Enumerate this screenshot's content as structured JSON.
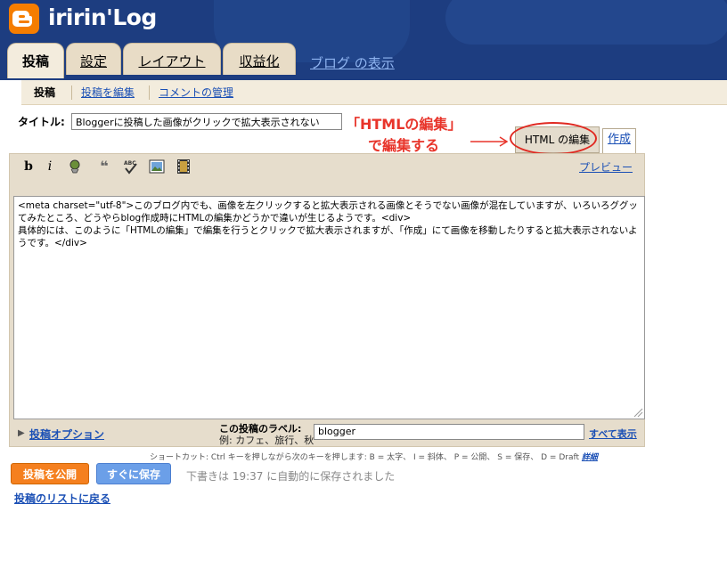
{
  "header": {
    "blog_title": "iririn'Log"
  },
  "tabs": [
    {
      "label": "投稿",
      "active": true
    },
    {
      "label": "設定"
    },
    {
      "label": "レイアウト"
    },
    {
      "label": "収益化"
    }
  ],
  "view_blog_link": "ブログ の表示",
  "subnav": [
    {
      "label": "投稿",
      "active": true
    },
    {
      "label": "投稿を編集"
    },
    {
      "label": "コメントの管理"
    }
  ],
  "post": {
    "title_label": "タイトル:",
    "title_value": "Bloggerに投稿した画像がクリックで拡大表示されない",
    "body": "<meta charset=\"utf-8\">このブログ内でも、画像を左クリックすると拡大表示される画像とそうでない画像が混在していますが、いろいろググッてみたところ、どうやらblog作成時にHTMLの編集かどうかで違いが生じるようです。<div>\n具体的には、このように「HTMLの編集」で編集を行うとクリックで拡大表示されますが、「作成」にて画像を移動したりすると拡大表示されないようです。</div>"
  },
  "annotation": {
    "line1": "「HTMLの編集」",
    "line2": "で編集する"
  },
  "mode_tabs": {
    "html": "HTML の編集",
    "compose": "作成"
  },
  "toolbar": {
    "bold": "b",
    "italic": "i",
    "preview": "プレビュー"
  },
  "options": {
    "post_options": "投稿オプション",
    "labels_title": "この投稿のラベル:",
    "labels_example": "例: カフェ、旅行、秋",
    "labels_value": "blogger",
    "show_all": "すべて表示"
  },
  "shortcut": {
    "text": "ショートカット: Ctrl キーを押しながら次のキーを押します: B = 太字、 I = 斜体、 P = 公開、 S = 保存、 D = Draft",
    "details": "詳細"
  },
  "actions": {
    "publish": "投稿を公開",
    "save_now": "すぐに保存",
    "autosave_status": "下書きは 19:37 に自動的に保存されました",
    "back_to_list": "投稿のリストに戻る"
  },
  "colors": {
    "header_bg": "#1d3d80",
    "accent_orange": "#f57d00",
    "link_blue": "#1a4fb5",
    "annotation_red": "#e8342a"
  }
}
